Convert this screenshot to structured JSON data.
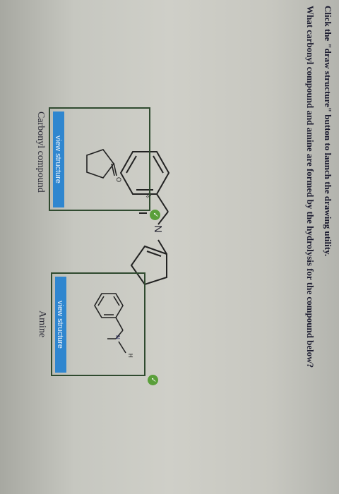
{
  "instructions": {
    "line1": "Click the \"draw structure\" button to launch the drawing utility.",
    "question": "What carbonyl compound and amine are formed by the hydrolysis for the compound below?"
  },
  "structure": {
    "n_label": "N"
  },
  "carbonyl": {
    "button_label": "view structure",
    "caption": "Carbonyl compound"
  },
  "amine": {
    "button_label": "view structure",
    "caption": "Amine"
  },
  "check_glyph": "✓",
  "colors": {
    "button_blue": "#2f86cf",
    "check_green": "#5a9f3a",
    "box_border": "#2f4a2f"
  }
}
